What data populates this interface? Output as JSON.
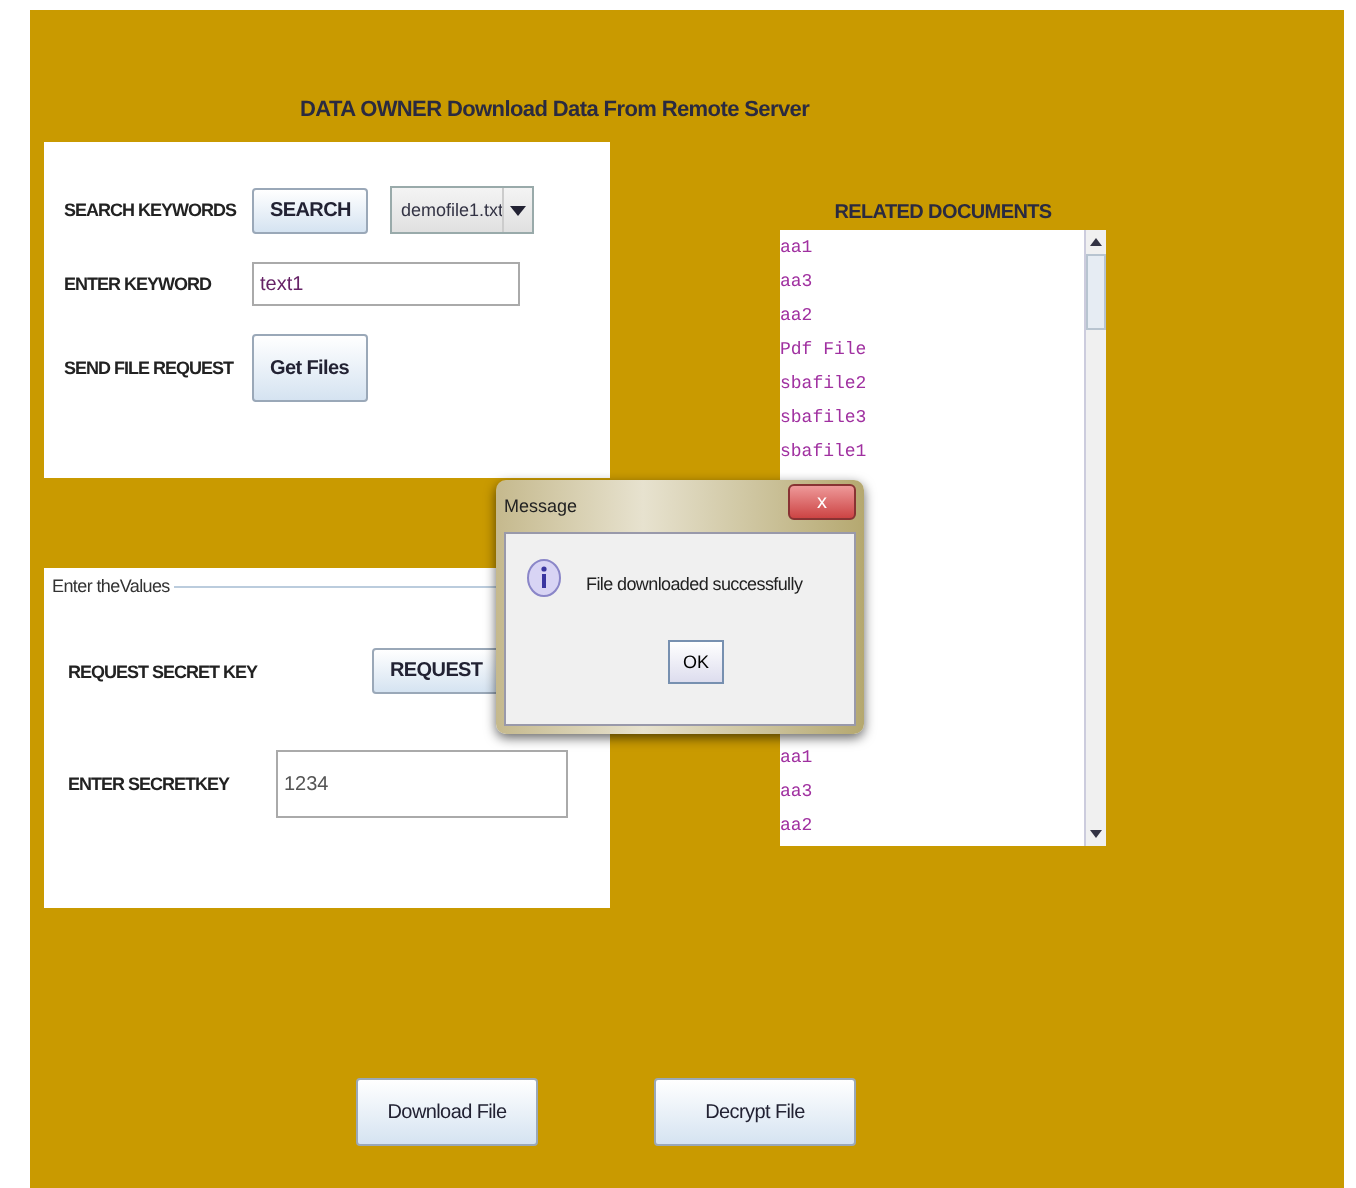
{
  "title": "DATA OWNER Download Data From Remote Server",
  "search_panel": {
    "rows": [
      {
        "kind": "search",
        "label": "SEARCH KEYWORDS",
        "button": "SEARCH",
        "dropdown": "demofile1.txt"
      },
      {
        "kind": "field",
        "label": "ENTER KEYWORD",
        "value": "text1"
      },
      {
        "kind": "button",
        "label": "SEND FILE REQUEST",
        "button": "Get Files"
      }
    ]
  },
  "values_panel": {
    "legend": "Enter theValues",
    "rows": [
      {
        "kind": "button",
        "label": "REQUEST SECRET KEY",
        "button": "REQUEST"
      },
      {
        "kind": "field",
        "label": "ENTER SECRETKEY",
        "value": "1234"
      }
    ]
  },
  "related_documents": {
    "title": "RELATED  DOCUMENTS",
    "items_top": [
      "aa1",
      "aa3",
      "aa2",
      "Pdf File",
      "sbafile2",
      "sbafile3",
      "sbafile1"
    ],
    "items_bottom": [
      "aa1",
      "aa3",
      "aa2"
    ]
  },
  "buttons": [
    "Download File",
    "Decrypt File"
  ],
  "dialog": {
    "title": "Message",
    "close": "x",
    "message": "File downloaded successfully",
    "button": "OK"
  }
}
